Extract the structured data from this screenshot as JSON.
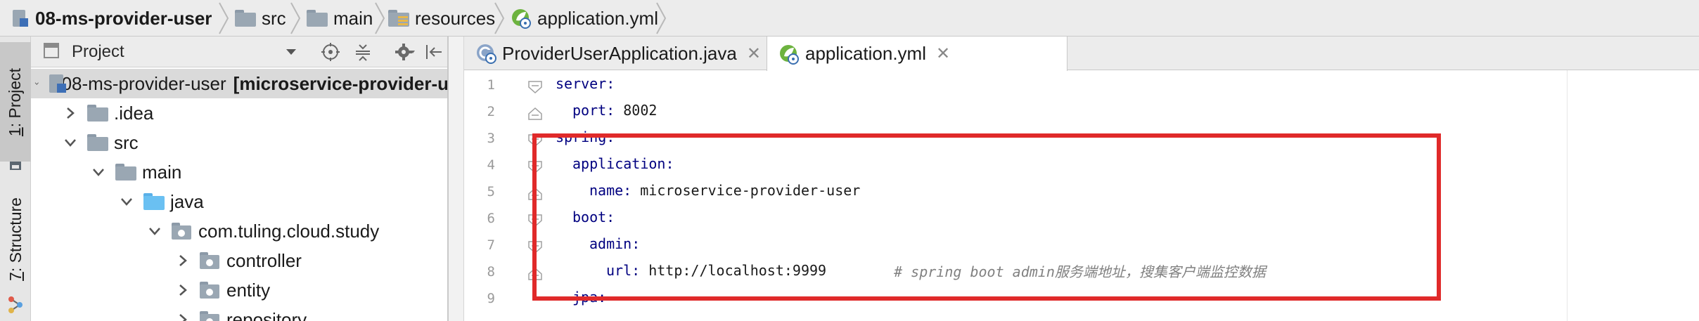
{
  "breadcrumb": {
    "module": "08-ms-provider-user",
    "src": "src",
    "main": "main",
    "resources": "resources",
    "file": "application.yml"
  },
  "side_tabs": {
    "project_num": "1",
    "project_label": ": Project",
    "structure_num": "7",
    "structure_label": ": Structure"
  },
  "project_panel": {
    "title": "Project",
    "tree": {
      "root_name": "08-ms-provider-user",
      "root_module": "[microservice-provider-u",
      "idea": ".idea",
      "src": "src",
      "main": "main",
      "java": "java",
      "package": "com.tuling.cloud.study",
      "controller": "controller",
      "entity": "entity",
      "repository": "repository"
    }
  },
  "editor": {
    "tabs": [
      {
        "label": "ProviderUserApplication.java"
      },
      {
        "label": "application.yml"
      }
    ],
    "line_numbers": [
      "1",
      "2",
      "3",
      "4",
      "5",
      "6",
      "7",
      "8",
      "9"
    ],
    "lines": [
      {
        "key": "server:",
        "value": ""
      },
      {
        "key": "port:",
        "value": " 8002"
      },
      {
        "key": "spring:",
        "value": ""
      },
      {
        "key": "application:",
        "value": ""
      },
      {
        "key": "name:",
        "value": " microservice-provider-user"
      },
      {
        "key": "boot:",
        "value": ""
      },
      {
        "key": "admin:",
        "value": ""
      },
      {
        "key": "url:",
        "value": " http://localhost:9999",
        "comment": "# spring boot admin服务端地址，搜集客户端监控数据"
      },
      {
        "key": "jpa:",
        "value": ""
      }
    ]
  },
  "colors": {
    "yaml_key": "#000080",
    "comment": "#808080",
    "highlight_border": "#e02a2a",
    "spring_icon": "#6db33f"
  }
}
